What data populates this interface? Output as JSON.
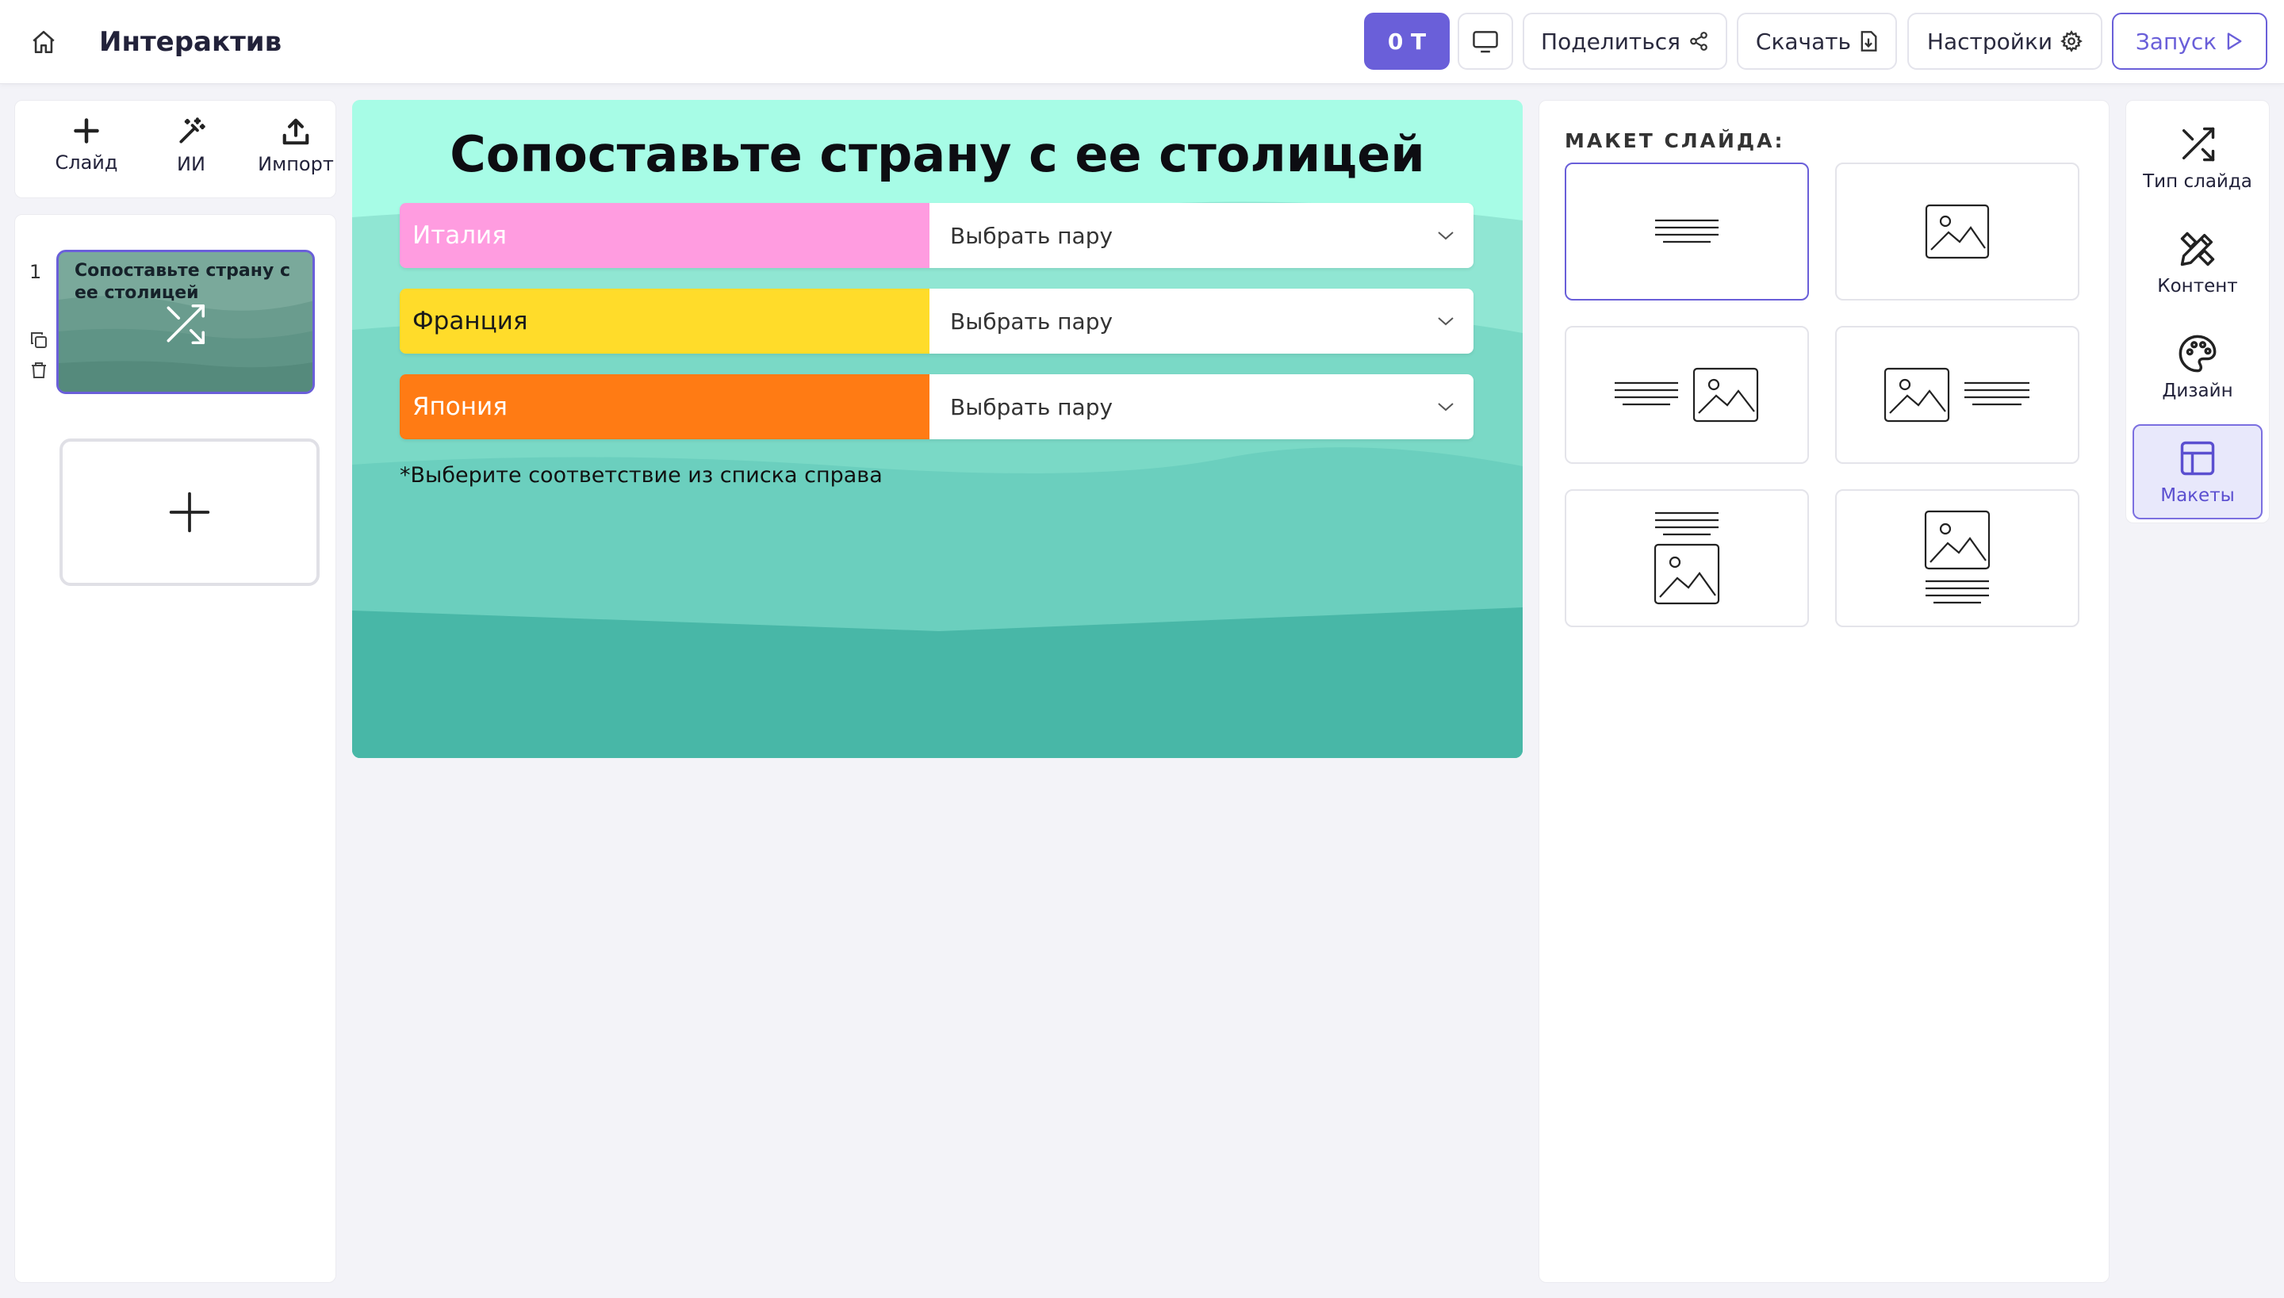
{
  "header": {
    "title": "Интерактив",
    "tokens_label": "0 T",
    "share_label": "Поделиться",
    "download_label": "Скачать",
    "settings_label": "Настройки",
    "launch_label": "Запуск"
  },
  "tools": {
    "slide_label": "Слайд",
    "ai_label": "ИИ",
    "import_label": "Импорт"
  },
  "slides_panel": {
    "slide_number": "1",
    "thumb_title": "Сопоставьте страну с ее столицей"
  },
  "slide": {
    "title": "Сопоставьте страну с ее столицей",
    "pairs": [
      {
        "country": "Италия",
        "select_placeholder": "Выбрать пару",
        "color": "#ff9ce0",
        "text_color": "#ffffff"
      },
      {
        "country": "Франция",
        "select_placeholder": "Выбрать пару",
        "color": "#ffdc2a",
        "text_color": "#1a1a1a"
      },
      {
        "country": "Япония",
        "select_placeholder": "Выбрать пару",
        "color": "#ff7b14",
        "text_color": "#ffffff"
      }
    ],
    "note": "*Выберите соответствие из списка справа"
  },
  "layout_panel": {
    "heading": "МАКЕТ СЛАЙДА:",
    "options": [
      "text-only",
      "image-only",
      "text-left-image-right",
      "image-left-text-right",
      "text-top-image-bottom",
      "image-top-text-bottom"
    ],
    "selected": "text-only"
  },
  "right_rail": {
    "items": [
      {
        "label": "Тип слайда",
        "icon": "shuffle-icon"
      },
      {
        "label": "Контент",
        "icon": "pencil-ruler-icon"
      },
      {
        "label": "Дизайн",
        "icon": "palette-icon"
      },
      {
        "label": "Макеты",
        "icon": "layout-icon"
      }
    ],
    "active": "Макеты"
  },
  "colors": {
    "accent": "#6a5fd9",
    "slide_bg_top": "#a7fce6",
    "slide_bg_bottom": "#48b7a7"
  }
}
